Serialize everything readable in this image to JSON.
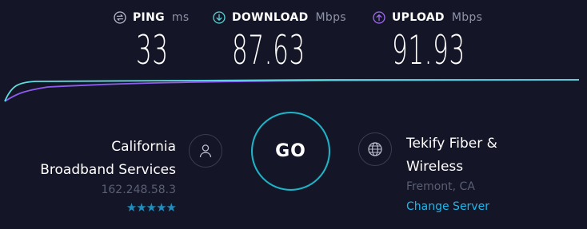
{
  "metrics": {
    "ping": {
      "label": "PING",
      "unit": "ms",
      "value": "33",
      "icon": "ping-icon"
    },
    "download": {
      "label": "DOWNLOAD",
      "unit": "Mbps",
      "value": "87.63",
      "icon": "download-arrow-icon",
      "color": "#5ad3d6"
    },
    "upload": {
      "label": "UPLOAD",
      "unit": "Mbps",
      "value": "91.93",
      "icon": "upload-arrow-icon",
      "color": "#a06cf0"
    }
  },
  "graph": {
    "download_color": "#5ce0e0",
    "upload_color": "#8d5cf0"
  },
  "isp": {
    "name_line1": "California",
    "name_line2": "Broadband Services",
    "ip": "162.248.58.3",
    "stars": "★★★★★",
    "rating": 5,
    "icon": "user-icon"
  },
  "go_button": {
    "label": "GO",
    "color": "#1fb4c8"
  },
  "server": {
    "name_line1": "Tekify Fiber &",
    "name_line2": "Wireless",
    "location": "Fremont, CA",
    "change_label": "Change Server",
    "icon": "globe-icon",
    "link_color": "#1eb6ea"
  }
}
